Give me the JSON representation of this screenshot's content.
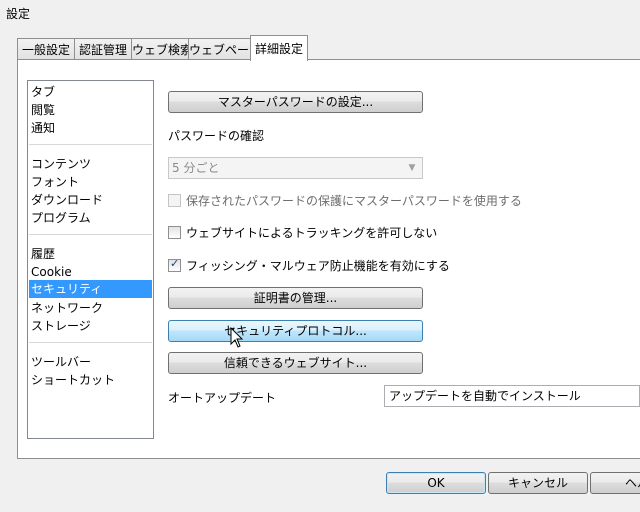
{
  "window": {
    "title": "設定"
  },
  "tabs": [
    {
      "label": "一般設定"
    },
    {
      "label": "認証管理"
    },
    {
      "label": "ウェブ検索"
    },
    {
      "label": "ウェブページ"
    },
    {
      "label": "詳細設定",
      "active": true
    }
  ],
  "categories": {
    "group1": [
      "タブ",
      "閲覧",
      "通知"
    ],
    "group2": [
      "コンテンツ",
      "フォント",
      "ダウンロード",
      "プログラム"
    ],
    "group3": [
      "履歴",
      "Cookie",
      "セキュリティ",
      "ネットワーク",
      "ストレージ"
    ],
    "group4": [
      "ツールバー",
      "ショートカット"
    ],
    "selected": "セキュリティ"
  },
  "security": {
    "master_password_button": "マスターパスワードの設定...",
    "password_confirm_label": "パスワードの確認",
    "password_interval_value": "5 分ごと",
    "master_password_protect_label": "保存されたパスワードの保護にマスターパスワードを使用する",
    "master_password_protect_checked": false,
    "do_not_track_label": "ウェブサイトによるトラッキングを許可しない",
    "do_not_track_checked": false,
    "fraud_protection_label": "フィッシング・マルウェア防止機能を有効にする",
    "fraud_protection_checked": true,
    "manage_certificates_button": "証明書の管理...",
    "security_protocols_button": "セキュリティプロトコル...",
    "trusted_websites_button": "信頼できるウェブサイト...",
    "auto_update_label": "オートアップデート",
    "auto_update_value": "アップデートを自動でインストール"
  },
  "footer": {
    "ok": "OK",
    "cancel": "キャンセル",
    "help": "ヘル"
  },
  "colors": {
    "selection": "#3399ff",
    "hover_button": "#bee6fd"
  }
}
